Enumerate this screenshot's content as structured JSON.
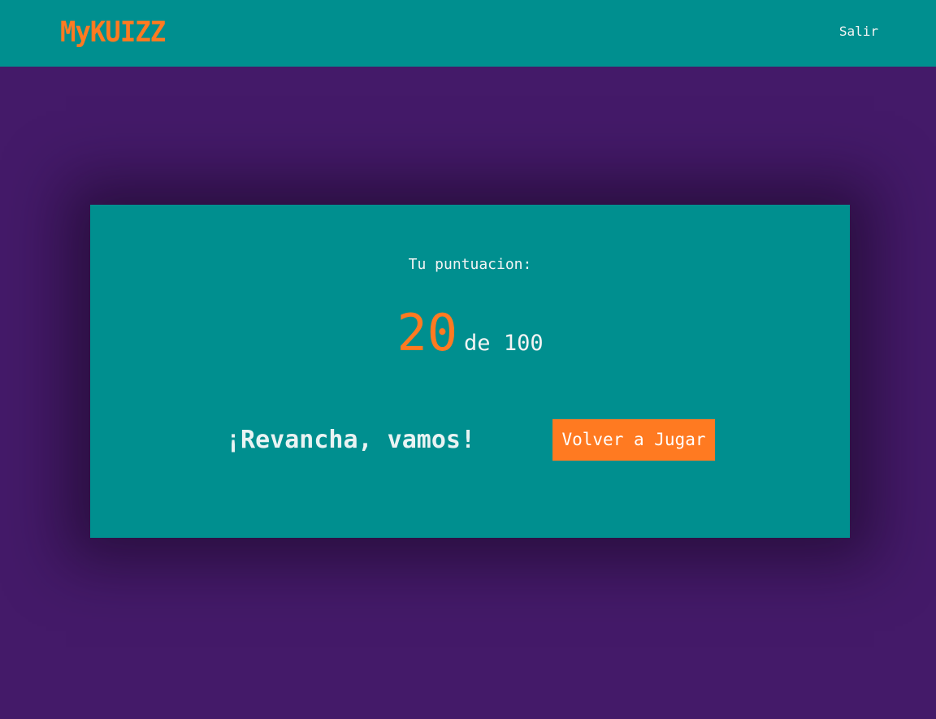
{
  "header": {
    "logo_text": "MyKUIZZ",
    "logout_label": "Salir"
  },
  "result": {
    "score_label": "Tu puntuacion:",
    "score": "20",
    "score_of": "de 100",
    "rematch_text": "¡Revancha, vamos!",
    "play_again_label": "Volver a Jugar"
  },
  "colors": {
    "background": "#441a69",
    "teal": "#008f8f",
    "accent_orange": "#ff7a21"
  }
}
